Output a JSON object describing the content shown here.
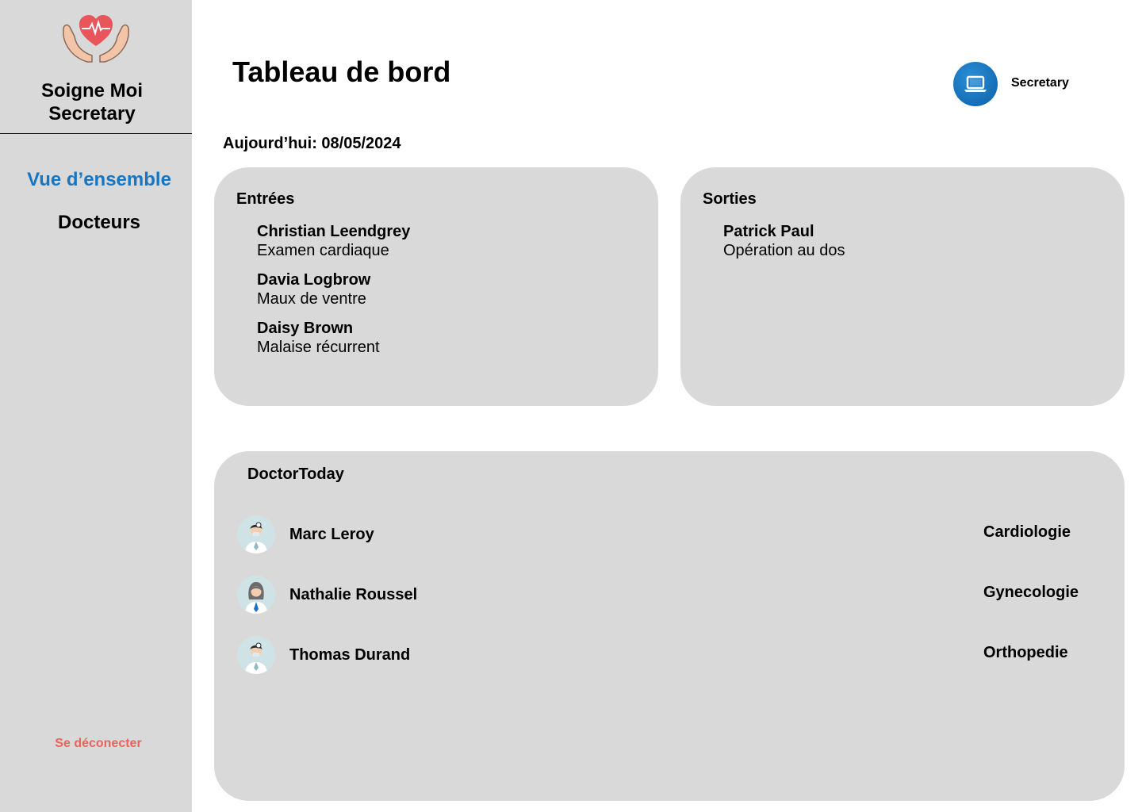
{
  "app": {
    "brand_line1": "Soigne Moi",
    "brand_line2": "Secretary",
    "logo_icon": "heart-hands-icon"
  },
  "sidebar": {
    "items": [
      {
        "label": "Vue d’ensemble",
        "active": true
      },
      {
        "label": "Docteurs",
        "active": false
      }
    ],
    "logout_label": "Se déconecter"
  },
  "header": {
    "title": "Tableau de bord",
    "user_label": "Secretary",
    "user_icon": "laptop-icon"
  },
  "date_line": "Aujourd’hui: 08/05/2024",
  "entries": {
    "title": "Entrées",
    "items": [
      {
        "name": "Christian Leendgrey",
        "reason": "Examen cardiaque"
      },
      {
        "name": "Davia Logbrow",
        "reason": "Maux de ventre"
      },
      {
        "name": "Daisy Brown",
        "reason": "Malaise récurrent"
      }
    ]
  },
  "exits": {
    "title": "Sorties",
    "items": [
      {
        "name": "Patrick Paul",
        "reason": "Opération au dos"
      }
    ]
  },
  "doctors_today": {
    "title": "DoctorToday",
    "items": [
      {
        "name": "Marc Leroy",
        "specialty": "Cardiologie",
        "avatar": "male-doctor-avatar"
      },
      {
        "name": "Nathalie Roussel",
        "specialty": "Gynecologie",
        "avatar": "female-doctor-avatar"
      },
      {
        "name": "Thomas Durand",
        "specialty": "Orthopedie",
        "avatar": "male-doctor-avatar"
      }
    ]
  },
  "colors": {
    "sidebar_bg": "#d9d9d9",
    "card_bg": "#d9d9d9",
    "active_nav": "#1577c4",
    "logout": "#e8655a",
    "heart": "#e8555a",
    "user_avatar": "#1a78c2"
  }
}
